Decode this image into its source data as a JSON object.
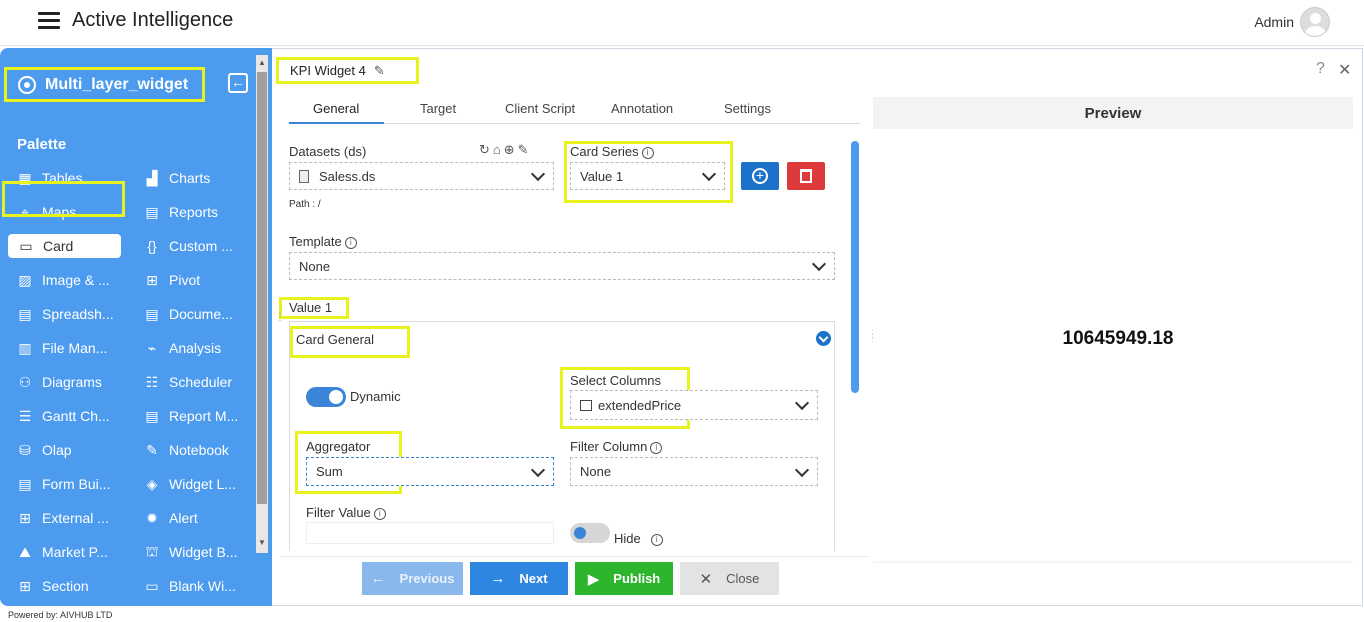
{
  "app": {
    "title": "Active Intelligence",
    "user": "Admin",
    "powered_by": "Powered by: AIVHUB LTD"
  },
  "sidebar": {
    "widget_name": "Multi_layer_widget",
    "palette_title": "Palette",
    "left_items": [
      {
        "label": "Tables",
        "icon": "table-icon"
      },
      {
        "label": "Maps",
        "icon": "map-icon"
      },
      {
        "label": "Card",
        "icon": "card-icon"
      },
      {
        "label": "Image & ...",
        "icon": "image-icon"
      },
      {
        "label": "Spreadsh...",
        "icon": "spreadsheet-icon"
      },
      {
        "label": "File Man...",
        "icon": "file-manager-icon"
      },
      {
        "label": "Diagrams",
        "icon": "diagram-icon"
      },
      {
        "label": "Gantt Ch...",
        "icon": "gantt-icon"
      },
      {
        "label": "Olap",
        "icon": "olap-icon"
      },
      {
        "label": "Form Bui...",
        "icon": "form-icon"
      },
      {
        "label": "External ...",
        "icon": "external-icon"
      },
      {
        "label": "Market P...",
        "icon": "market-icon"
      },
      {
        "label": "Section",
        "icon": "section-icon"
      }
    ],
    "right_items": [
      {
        "label": "Charts",
        "icon": "chart-icon"
      },
      {
        "label": "Reports",
        "icon": "report-icon"
      },
      {
        "label": "Custom ...",
        "icon": "code-icon"
      },
      {
        "label": "Pivot",
        "icon": "pivot-icon"
      },
      {
        "label": "Docume...",
        "icon": "document-icon"
      },
      {
        "label": "Analysis",
        "icon": "analysis-icon"
      },
      {
        "label": "Scheduler",
        "icon": "scheduler-icon"
      },
      {
        "label": "Report M...",
        "icon": "report-manager-icon"
      },
      {
        "label": "Notebook",
        "icon": "notebook-icon"
      },
      {
        "label": "Widget L...",
        "icon": "layers-icon"
      },
      {
        "label": "Alert",
        "icon": "alert-icon"
      },
      {
        "label": "Widget B...",
        "icon": "widget-builder-icon"
      },
      {
        "label": "Blank Wi...",
        "icon": "blank-widget-icon"
      }
    ]
  },
  "editor": {
    "widget_title": "KPI Widget 4",
    "tabs": [
      "General",
      "Target",
      "Client Script",
      "Annotation",
      "Settings"
    ],
    "datasets_label": "Datasets (ds)",
    "dataset_value": "Saless.ds",
    "path_label": "Path : /",
    "card_series_label": "Card Series",
    "card_series_value": "Value 1",
    "template_label": "Template",
    "template_value": "None",
    "value_section": "Value 1",
    "card_general": "Card General",
    "dynamic_label": "Dynamic",
    "select_columns_label": "Select Columns",
    "select_columns_value": "extendedPrice",
    "aggregator_label": "Aggregator",
    "aggregator_value": "Sum",
    "filter_column_label": "Filter Column",
    "filter_column_value": "None",
    "filter_value_label": "Filter Value",
    "hide_label": "Hide"
  },
  "buttons": {
    "previous": "Previous",
    "next": "Next",
    "publish": "Publish",
    "close": "Close"
  },
  "preview": {
    "title": "Preview",
    "value": "10645949.18"
  },
  "colors": {
    "sidebar": "#4c9bef",
    "accent": "#1a73c9",
    "highlight": "#e8f21d",
    "publish": "#2db52d",
    "delete": "#dd3b3b"
  }
}
